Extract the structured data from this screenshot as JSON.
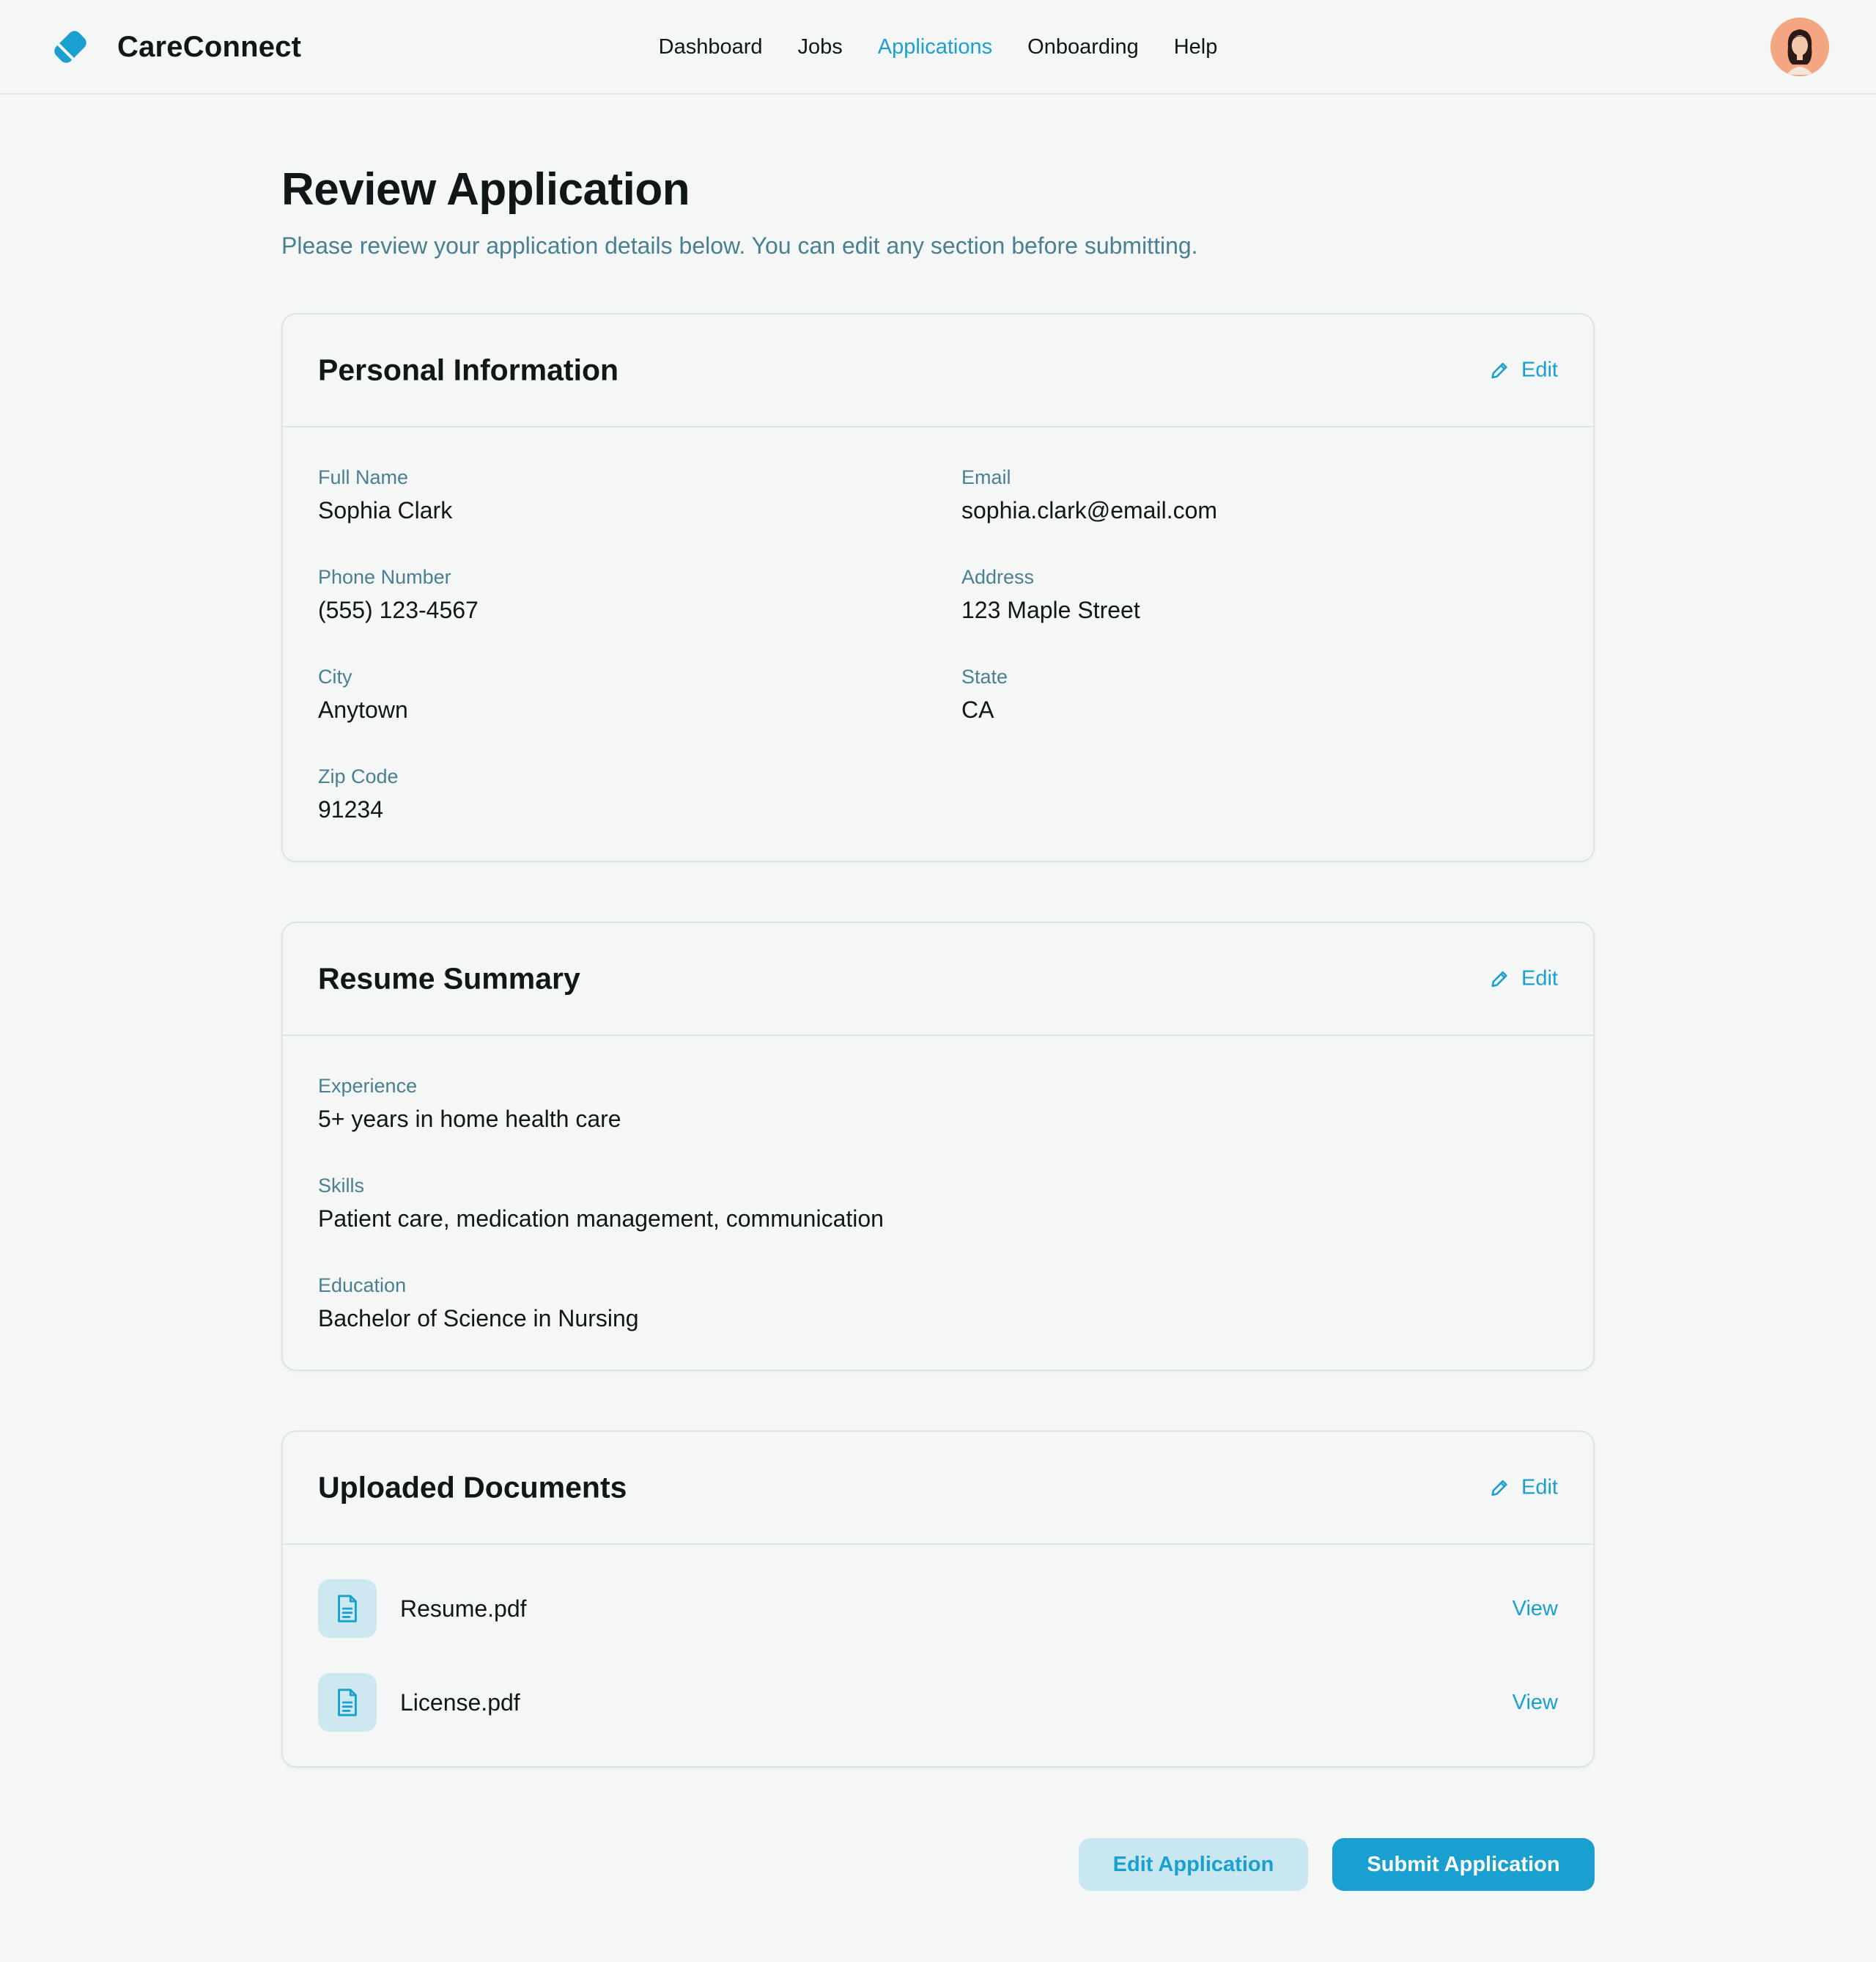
{
  "app": {
    "name": "CareConnect",
    "accent_color": "#1aa0d0"
  },
  "nav": {
    "items": [
      "Dashboard",
      "Jobs",
      "Applications",
      "Onboarding",
      "Help"
    ],
    "active": "Applications"
  },
  "user": {
    "avatar_icon": "user-avatar"
  },
  "page": {
    "title": "Review Application",
    "subtitle": "Please review your application details below. You can edit any section before submitting."
  },
  "personal_info": {
    "title": "Personal Information",
    "edit_label": "Edit",
    "fields": [
      {
        "label": "Full Name",
        "value": "Sophia Clark"
      },
      {
        "label": "Email",
        "value": "sophia.clark@email.com"
      },
      {
        "label": "Phone Number",
        "value": "(555) 123-4567"
      },
      {
        "label": "Address",
        "value": "123 Maple Street"
      },
      {
        "label": "City",
        "value": "Anytown"
      },
      {
        "label": "State",
        "value": "CA"
      },
      {
        "label": "Zip Code",
        "value": "91234"
      }
    ]
  },
  "resume": {
    "title": "Resume Summary",
    "edit_label": "Edit",
    "fields": [
      {
        "label": "Experience",
        "value": "5+ years in home health care"
      },
      {
        "label": "Skills",
        "value": "Patient care, medication management, communication"
      },
      {
        "label": "Education",
        "value": "Bachelor of Science in Nursing"
      }
    ]
  },
  "documents": {
    "title": "Uploaded Documents",
    "edit_label": "Edit",
    "items": [
      {
        "name": "Resume.pdf",
        "action": "View",
        "icon": "document-icon"
      },
      {
        "name": "License.pdf",
        "action": "View",
        "icon": "document-icon"
      }
    ]
  },
  "actions": {
    "edit_label": "Edit Application",
    "submit_label": "Submit Application"
  }
}
